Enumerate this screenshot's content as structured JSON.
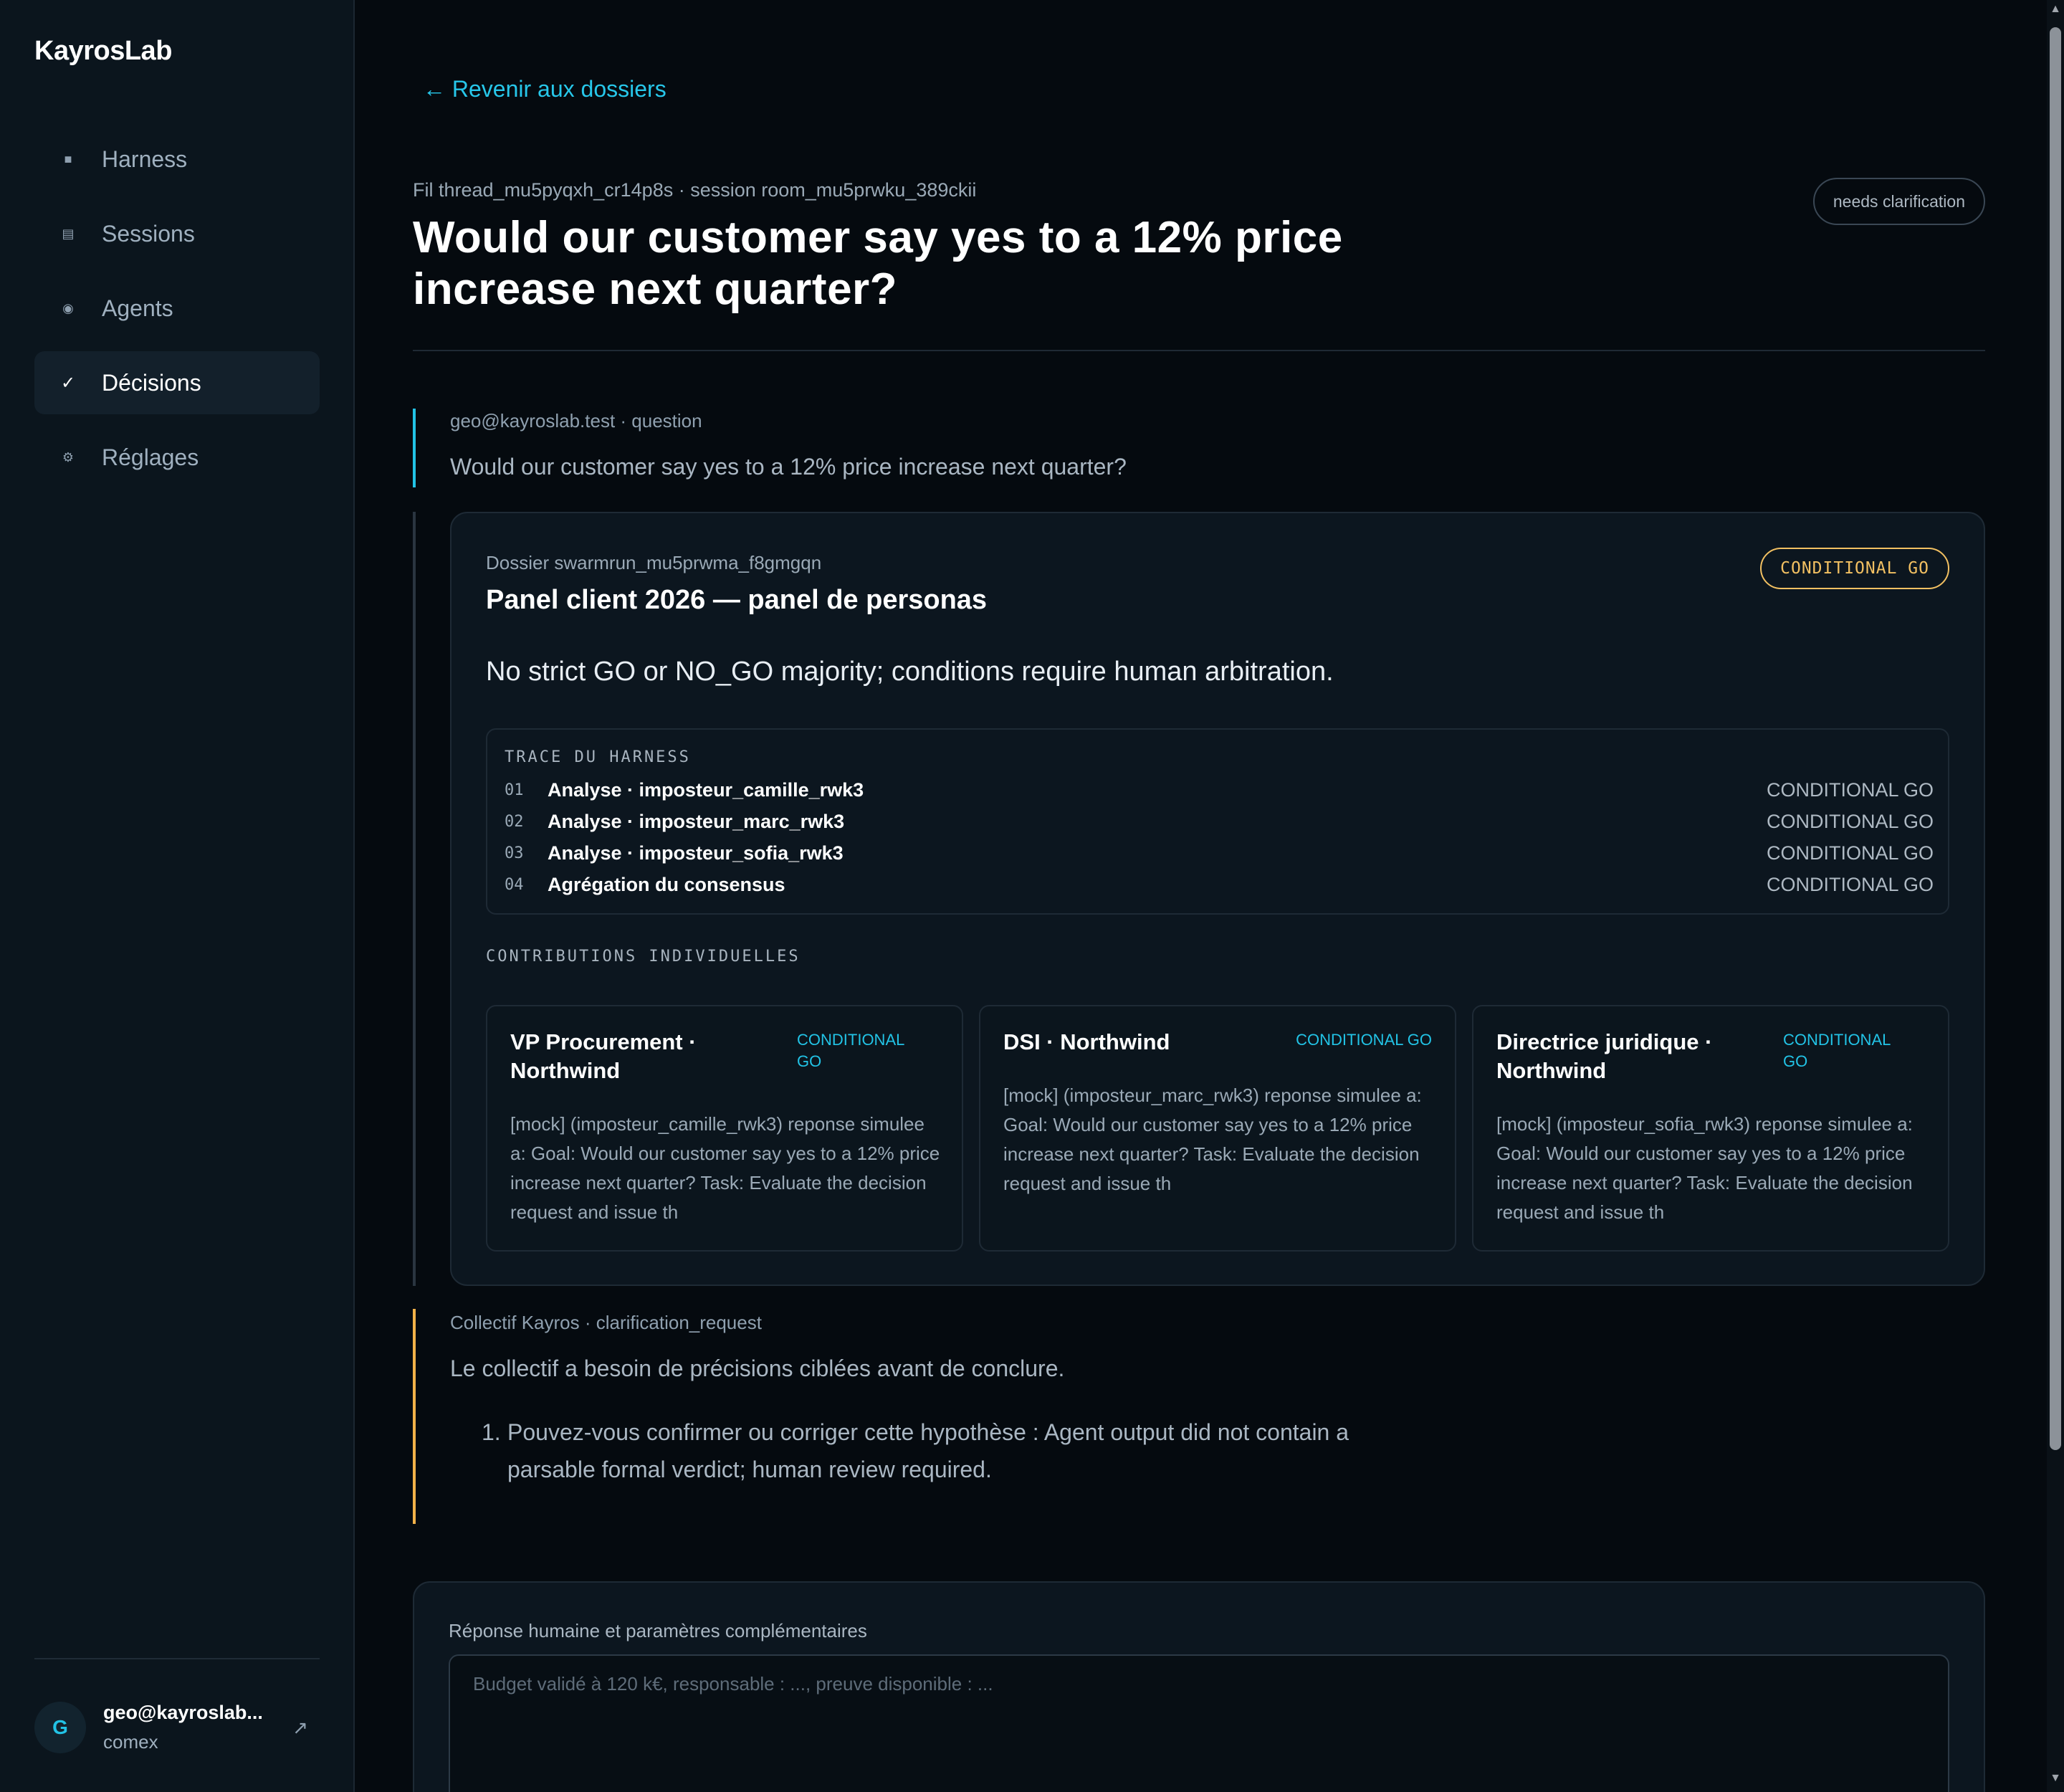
{
  "sidebar": {
    "logo": "KayrosLab",
    "items": [
      {
        "label": "Harness",
        "icon": "■"
      },
      {
        "label": "Sessions",
        "icon": "▤"
      },
      {
        "label": "Agents",
        "icon": "◉"
      },
      {
        "label": "Décisions",
        "icon": "✓"
      },
      {
        "label": "Réglages",
        "icon": "⚙"
      }
    ],
    "user": {
      "initial": "G",
      "email": "geo@kayroslab...",
      "role": "comex",
      "link_icon": "↗"
    }
  },
  "main": {
    "back_link": "← Revenir aux dossiers",
    "meta": "Fil thread_mu5pyqxh_cr14p8s · session room_mu5prwku_389ckii",
    "title": "Would our customer say yes to a 12% price increase next quarter?",
    "status": "needs clarification",
    "question": {
      "meta": "geo@kayroslab.test · question",
      "text": "Would our customer say yes to a 12% price increase next quarter?"
    },
    "dossier": {
      "label": "Dossier swarmrun_mu5prwma_f8gmgqn",
      "title": "Panel client 2026 — panel de personas",
      "verdict": "CONDITIONAL GO",
      "summary": "No strict GO or NO_GO majority; conditions require human arbitration.",
      "trace": {
        "heading": "TRACE DU HARNESS",
        "rows": [
          {
            "num": "01",
            "label": "Analyse · imposteur_camille_rwk3",
            "verdict": "CONDITIONAL GO"
          },
          {
            "num": "02",
            "label": "Analyse · imposteur_marc_rwk3",
            "verdict": "CONDITIONAL GO"
          },
          {
            "num": "03",
            "label": "Analyse · imposteur_sofia_rwk3",
            "verdict": "CONDITIONAL GO"
          },
          {
            "num": "04",
            "label": "Agrégation du consensus",
            "verdict": "CONDITIONAL GO"
          }
        ]
      },
      "contributions_heading": "CONTRIBUTIONS INDIVIDUELLES",
      "contributions": [
        {
          "name": "VP Procurement · Northwind",
          "verdict": "CONDITIONAL GO",
          "body": "[mock] (imposteur_camille_rwk3) reponse simulee a: Goal: Would our customer say yes to a 12% price increase next quarter? Task: Evaluate the decision request and issue th"
        },
        {
          "name": "DSI · Northwind",
          "verdict": "CONDITIONAL GO",
          "body": "[mock] (imposteur_marc_rwk3) reponse simulee a: Goal: Would our customer say yes to a 12% price increase next quarter? Task: Evaluate the decision request and issue th"
        },
        {
          "name": "Directrice juridique · Northwind",
          "verdict": "CONDITIONAL GO",
          "body": "[mock] (imposteur_sofia_rwk3) reponse simulee a: Goal: Would our customer say yes to a 12% price increase next quarter? Task: Evaluate the decision request and issue th"
        }
      ]
    },
    "clarification": {
      "meta": "Collectif Kayros · clarification_request",
      "text": "Le collectif a besoin de précisions ciblées avant de conclure.",
      "items": [
        {
          "num": "1.",
          "text": "Pouvez-vous confirmer ou corriger cette hypothèse : Agent output did not contain a parsable formal verdict; human review required."
        }
      ]
    },
    "reply": {
      "label": "Réponse humaine et paramètres complémentaires",
      "placeholder": "Budget validé à 120 k€, responsable : ..., preuve disponible : ..."
    }
  },
  "colors": {
    "accent": "#22c3e6",
    "warning": "#f2c062",
    "clarification_rail": "#f2b249",
    "background": "#050a0f"
  }
}
